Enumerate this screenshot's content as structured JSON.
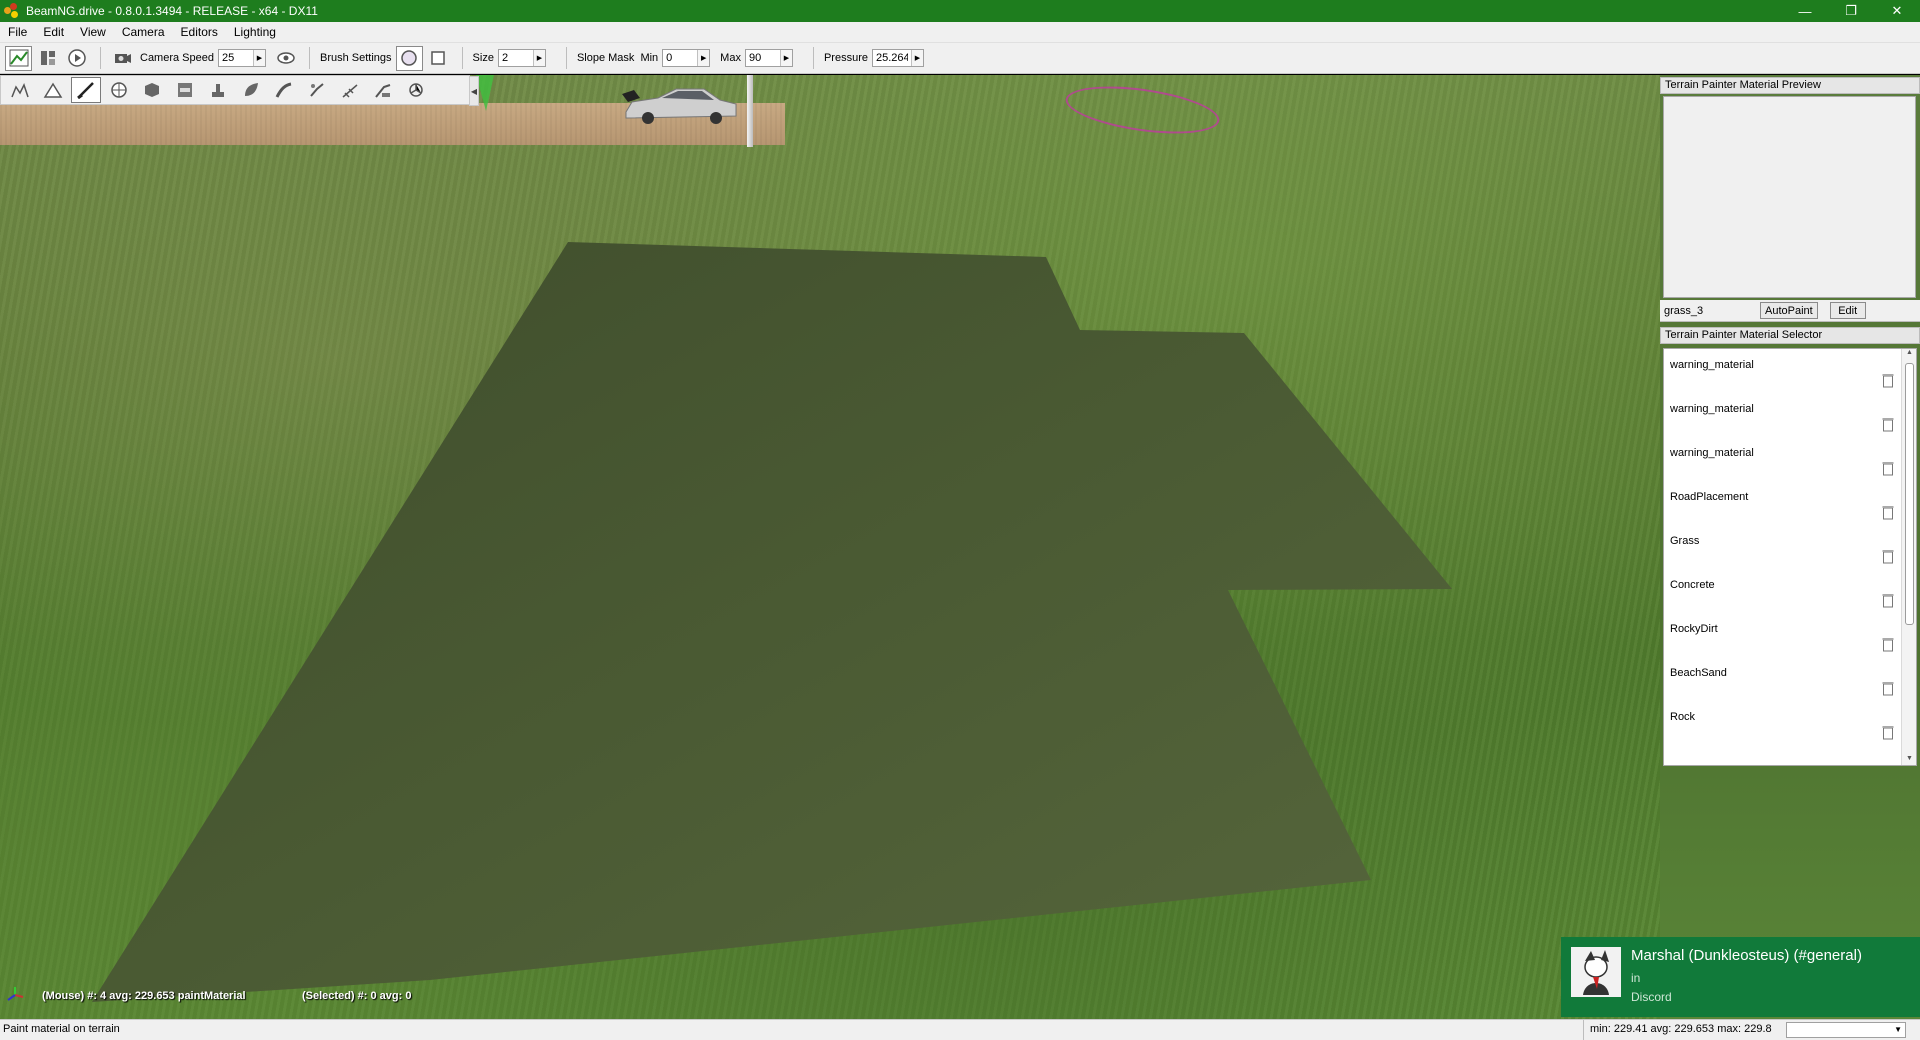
{
  "window": {
    "title": "BeamNG.drive - 0.8.0.1.3494 - RELEASE - x64 - DX11",
    "minimize": "—",
    "maximize": "❐",
    "close": "✕"
  },
  "menu": [
    "File",
    "Edit",
    "View",
    "Camera",
    "Editors",
    "Lighting"
  ],
  "toolbar": {
    "camera_speed_label": "Camera Speed",
    "camera_speed_value": "25",
    "brush_settings_label": "Brush Settings",
    "size_label": "Size",
    "size_value": "2",
    "slope_mask_label": "Slope Mask",
    "min_label": "Min",
    "min_value": "0",
    "max_label": "Max",
    "max_value": "90",
    "pressure_label": "Pressure",
    "pressure_value": "25.264"
  },
  "viewport": {
    "mouse_stat": "(Mouse) #: 4  avg: 229.653 paintMaterial",
    "selected_stat": "(Selected) #: 0  avg: 0"
  },
  "preview_panel": {
    "header": "Terrain Painter Material Preview",
    "material_name": "grass_3",
    "autopaint_label": "AutoPaint",
    "edit_label": "Edit"
  },
  "selector_panel": {
    "header": "Terrain Painter Material Selector",
    "materials": [
      "warning_material",
      "warning_material",
      "warning_material",
      "RoadPlacement",
      "Grass",
      "Concrete",
      "RockyDirt",
      "BeachSand",
      "Rock"
    ]
  },
  "notification": {
    "title": "Marshal (Dunkleosteus) (#general)",
    "line2": "in",
    "line3": "Discord"
  },
  "status": {
    "left": "Paint material on terrain",
    "right": "min: 229.41  avg: 229.653  max: 229.8"
  },
  "colors": {
    "titlebar": "#1e7d1e",
    "notification": "#117a3a",
    "painted_area": "#4d5c36"
  }
}
